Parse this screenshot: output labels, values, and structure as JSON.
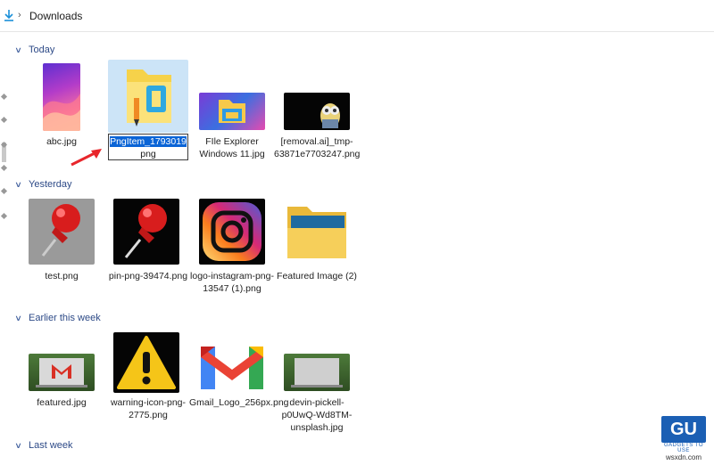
{
  "breadcrumb": {
    "location": "Downloads"
  },
  "groups": [
    {
      "label": "Today"
    },
    {
      "label": "Yesterday"
    },
    {
      "label": "Earlier this week"
    },
    {
      "label": "Last week"
    }
  ],
  "today": [
    {
      "name": "abc.jpg"
    },
    {
      "rename_selected": "PngItem_1793019",
      "rename_rest": "png"
    },
    {
      "name": "FIle Explorer Windows 11.jpg"
    },
    {
      "name": "[removal.ai]_tmp-63871e7703247.png"
    }
  ],
  "yesterday": [
    {
      "name": "test.png"
    },
    {
      "name": "pin-png-39474.png"
    },
    {
      "name": "logo-instagram-png-13547 (1).png"
    },
    {
      "name": "Featured Image (2)"
    }
  ],
  "earlier": [
    {
      "name": "featured.jpg"
    },
    {
      "name": "warning-icon-png-2775.png"
    },
    {
      "name": "Gmail_Logo_256px.png"
    },
    {
      "name": "devin-pickell-p0UwQ-Wd8TM-unsplash.jpg"
    }
  ],
  "watermark": {
    "logo": "GU",
    "tagline": "GADGETS TO USE",
    "site": "wsxdn.com"
  },
  "colors": {
    "selection": "#cce4f7",
    "group_header": "#2d4a87",
    "arrow": "#e8262b"
  }
}
